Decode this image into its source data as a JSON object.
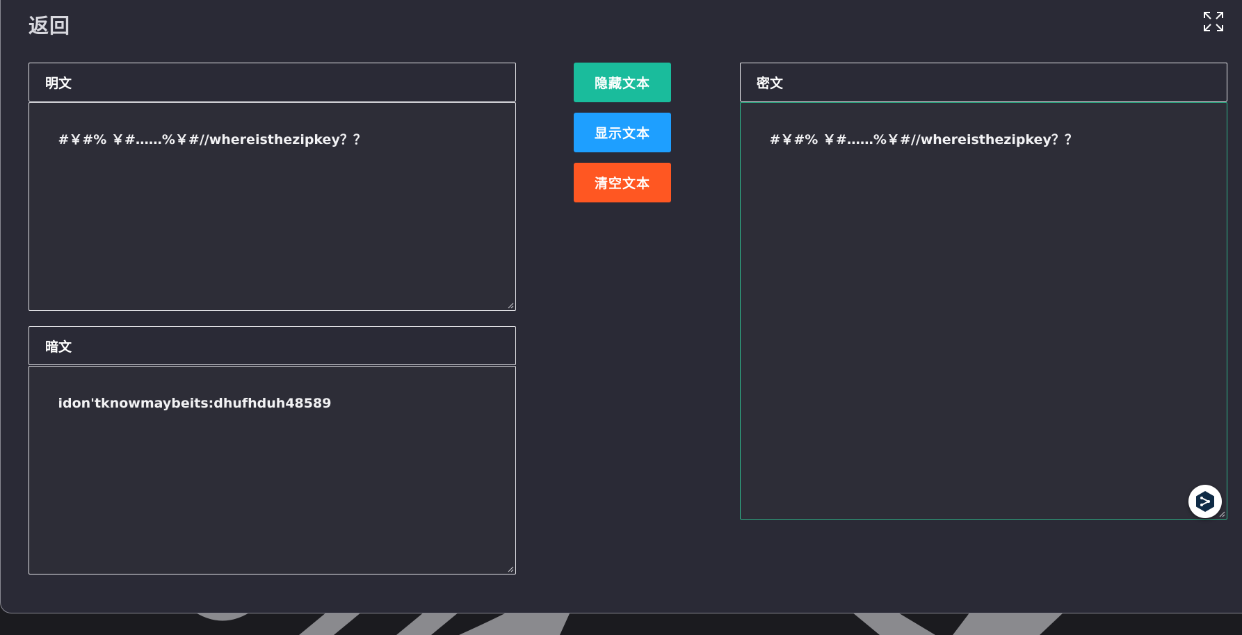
{
  "header": {
    "back_label": "返回"
  },
  "plaintext": {
    "title": "明文",
    "value": "#￥#% ￥#……%￥#//whereisthezipkey？？"
  },
  "hidden": {
    "title": "暗文",
    "value": "idon'tknowmaybeits:dhufhduh48589"
  },
  "ciphertext": {
    "title": "密文",
    "value": "#￥#% ￥#……%￥#//whereisthezipkey？？"
  },
  "actions": {
    "hide_label": "隐藏文本",
    "show_label": "显示文本",
    "clear_label": "清空文本"
  },
  "colors": {
    "hide_button": "#1abc9c",
    "show_button": "#1e9fff",
    "clear_button": "#ff5722",
    "focus_border": "#2fb58a",
    "panel_bg": "#2a2a36"
  },
  "icons": {
    "fullscreen": "expand-icon",
    "floating": "translate-badge-icon"
  }
}
